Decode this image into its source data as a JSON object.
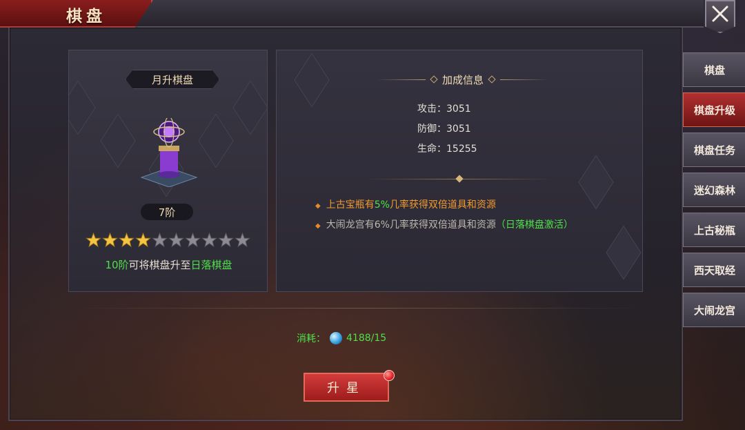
{
  "window": {
    "title": "棋盘"
  },
  "left": {
    "board_name": "月升棋盘",
    "level": "7阶",
    "stars_filled": 4,
    "stars_total": 10,
    "hint_prefix": "10阶",
    "hint_middle": "可将棋盘升至",
    "hint_target": "日落棋盘"
  },
  "right": {
    "section_title": "加成信息",
    "stats": [
      {
        "label": "攻击：3051"
      },
      {
        "label": "防御：3051"
      },
      {
        "label": "生命：15255"
      }
    ],
    "bonus1_prefix": "上古宝瓶有",
    "bonus1_percent": "5%",
    "bonus1_suffix": "几率获得双倍道具和资源",
    "bonus2_text": "大闹龙宫有6%几率获得双倍道具和资源",
    "bonus2_note": "（日落棋盘激活）"
  },
  "cost": {
    "label": "消耗：",
    "value": "4188/15"
  },
  "button": {
    "label": "升星"
  },
  "tabs": [
    {
      "label": "棋盘",
      "active": false
    },
    {
      "label": "棋盘升级",
      "active": true
    },
    {
      "label": "棋盘任务",
      "active": false
    },
    {
      "label": "迷幻森林",
      "active": false
    },
    {
      "label": "上古秘瓶",
      "active": false
    },
    {
      "label": "西天取经",
      "active": false
    },
    {
      "label": "大闹龙宫",
      "active": false
    }
  ],
  "colors": {
    "accent_green": "#4fe04a",
    "accent_orange": "#f29a2e",
    "tab_active": "#b23030"
  }
}
